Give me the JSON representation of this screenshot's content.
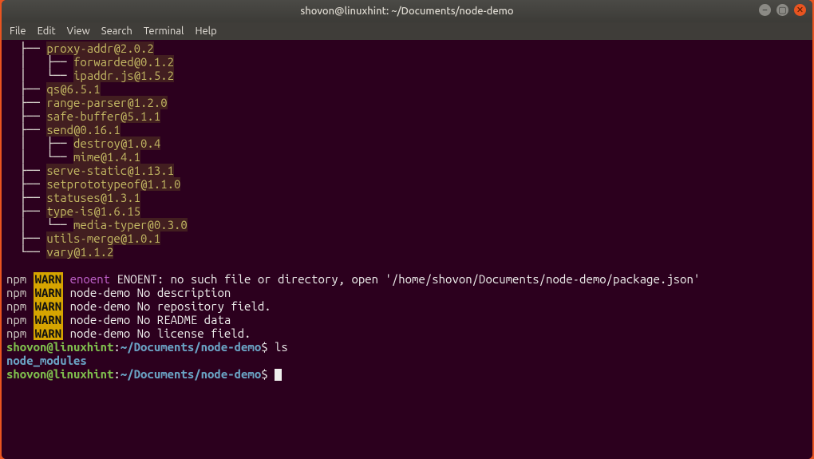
{
  "window": {
    "title": "shovon@linuxhint: ~/Documents/node-demo"
  },
  "menubar": {
    "items": [
      "File",
      "Edit",
      "View",
      "Search",
      "Terminal",
      "Help"
    ]
  },
  "tree": {
    "lines": [
      {
        "prefix": "  ├── ",
        "pkg": "proxy-addr@2.0.2"
      },
      {
        "prefix": "  │   ├── ",
        "pkg": "forwarded@0.1.2"
      },
      {
        "prefix": "  │   └── ",
        "pkg": "ipaddr.js@1.5.2"
      },
      {
        "prefix": "  ├── ",
        "pkg": "qs@6.5.1"
      },
      {
        "prefix": "  ├── ",
        "pkg": "range-parser@1.2.0"
      },
      {
        "prefix": "  ├── ",
        "pkg": "safe-buffer@5.1.1"
      },
      {
        "prefix": "  ├── ",
        "pkg": "send@0.16.1"
      },
      {
        "prefix": "  │   ├── ",
        "pkg": "destroy@1.0.4"
      },
      {
        "prefix": "  │   └── ",
        "pkg": "mime@1.4.1"
      },
      {
        "prefix": "  ├── ",
        "pkg": "serve-static@1.13.1"
      },
      {
        "prefix": "  ├── ",
        "pkg": "setprototypeof@1.1.0"
      },
      {
        "prefix": "  ├── ",
        "pkg": "statuses@1.3.1"
      },
      {
        "prefix": "  ├── ",
        "pkg": "type-is@1.6.15"
      },
      {
        "prefix": "  │   └── ",
        "pkg": "media-typer@0.3.0"
      },
      {
        "prefix": "  ├── ",
        "pkg": "utils-merge@1.0.1"
      },
      {
        "prefix": "  └── ",
        "pkg": "vary@1.1.2"
      }
    ]
  },
  "npm_warns": {
    "label": "npm",
    "warn": "WARN",
    "lines": [
      {
        "tag": "enoent",
        "magenta": true,
        "msg": "ENOENT: no such file or directory, open '/home/shovon/Documents/node-demo/package.json'"
      },
      {
        "tag": "node-demo",
        "magenta": false,
        "msg": "No description"
      },
      {
        "tag": "node-demo",
        "magenta": false,
        "msg": "No repository field."
      },
      {
        "tag": "node-demo",
        "magenta": false,
        "msg": "No README data"
      },
      {
        "tag": "node-demo",
        "magenta": false,
        "msg": "No license field."
      }
    ]
  },
  "prompts": [
    {
      "user": "shovon@linuxhint",
      "sep": ":",
      "path": "~/Documents/node-demo",
      "dollar": "$",
      "cmd": "ls"
    }
  ],
  "ls_output": "node_modules",
  "prompt2": {
    "user": "shovon@linuxhint",
    "sep": ":",
    "path": "~/Documents/node-demo",
    "dollar": "$"
  }
}
